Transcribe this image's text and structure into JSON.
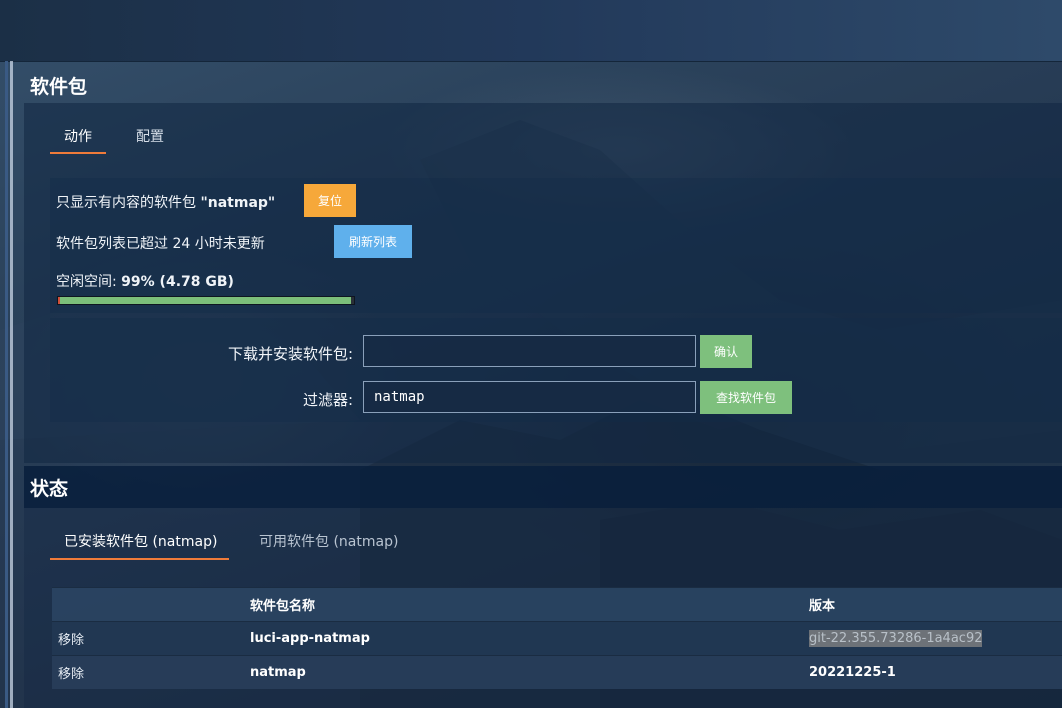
{
  "packages_section": {
    "title": "软件包",
    "tabs": [
      {
        "label": "动作",
        "active": true
      },
      {
        "label": "配置",
        "active": false
      }
    ],
    "filter_notice_prefix": "只显示有内容的软件包",
    "filter_notice_value": "\"natmap\"",
    "reset_button": "复位",
    "list_notice": "软件包列表已超过 24 小时未更新",
    "refresh_button": "刷新列表",
    "free_space_label": "空闲空间: ",
    "free_space_value": "99% (4.78 GB)",
    "free_space_fraction": 0.99,
    "download_label": "下载并安装软件包:",
    "download_value": "",
    "download_placeholder": "",
    "confirm_button": "确认",
    "filter_label": "过滤器:",
    "filter_value": "natmap",
    "find_button": "查找软件包"
  },
  "status_section": {
    "title": "状态",
    "tabs": [
      {
        "label": "已安装软件包 (natmap)",
        "active": true
      },
      {
        "label": "可用软件包 (natmap)",
        "active": false
      }
    ],
    "table": {
      "headers": [
        "",
        "软件包名称",
        "版本"
      ],
      "rows": [
        {
          "action": "移除",
          "name": "luci-app-natmap",
          "version": "git-22.355.73286-1a4ac92"
        },
        {
          "action": "移除",
          "name": "natmap",
          "version": "20221225-1"
        }
      ]
    }
  },
  "colors": {
    "accent_tab": "#ef7b3a",
    "reset_button": "#f6a83a",
    "refresh_button": "#5fb0ec",
    "green_button": "#7ec07d"
  }
}
